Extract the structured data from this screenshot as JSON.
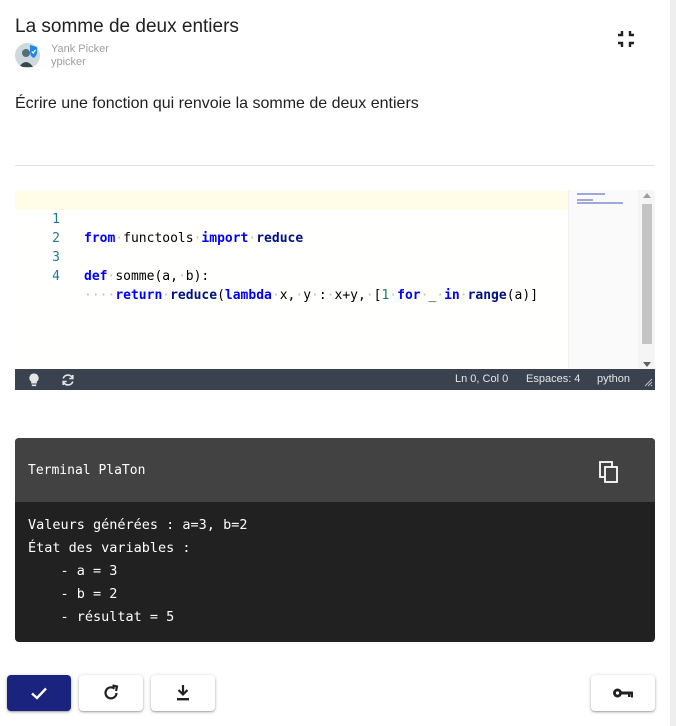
{
  "exercise": {
    "title": "La somme de deux entiers",
    "author_name": "Yank Picker",
    "author_username": "ypicker",
    "statement": "Écrire une fonction qui renvoie la somme de deux entiers"
  },
  "editor": {
    "lines": [
      {
        "number": "1"
      },
      {
        "number": "2"
      },
      {
        "number": "3"
      },
      {
        "number": "4"
      }
    ],
    "code_tokens": {
      "from": "from",
      "functools": "functools",
      "import": "import",
      "reduce": "reduce",
      "def": "def",
      "somme_sig_a": "somme(a,",
      "b_paren": "b):",
      "return": "return",
      "lambda": "lambda",
      "x": "x,",
      "y": "y",
      "colon": ":",
      "xy": "x+y,",
      "bracket": "[",
      "one": "1",
      "for": "for",
      "underscore": "_",
      "in": "in",
      "range": "range",
      "range_arg": "(a)]"
    },
    "status": {
      "position": "Ln 0, Col 0",
      "spaces": "Espaces: 4",
      "language": "python"
    }
  },
  "terminal": {
    "title": "Terminal PlaTon",
    "lines": [
      "Valeurs générées : a=3, b=2",
      "État des variables :",
      "    - a = 3",
      "    - b = 2",
      "    - résultat = 5"
    ]
  },
  "colors": {
    "primary": "#1a237e",
    "terminal_header": "#424242",
    "terminal_body": "#212121",
    "statusbar": "#3a4250"
  },
  "icons": {
    "collapse": "fullscreen-exit-icon",
    "lightbulb": "lightbulb-icon",
    "sync": "sync-icon",
    "copy": "copy-icon",
    "check": "check-icon",
    "refresh": "refresh-icon",
    "download": "download-icon",
    "key": "key-icon"
  }
}
